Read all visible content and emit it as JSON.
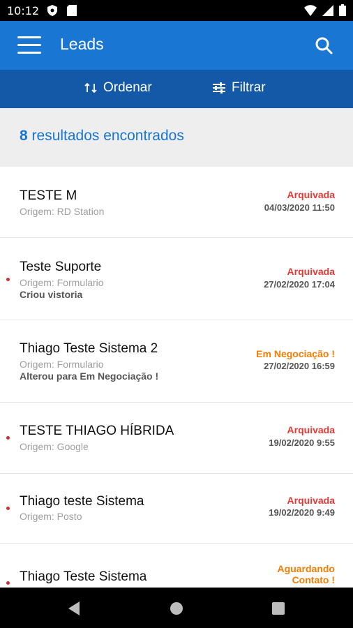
{
  "status_bar": {
    "time": "10:12"
  },
  "app_bar": {
    "title": "Leads"
  },
  "toolbar": {
    "sort_label": "Ordenar",
    "filter_label": "Filtrar"
  },
  "results": {
    "count": "8",
    "label": "resultados encontrados"
  },
  "leads": [
    {
      "name": "TESTE M",
      "origin": "Origem: RD Station",
      "activity": "",
      "status": "Arquivada",
      "status_color": "#e53935",
      "date": "04/03/2020 11:50",
      "unread": false
    },
    {
      "name": "Teste Suporte",
      "origin": "Origem: Formulario",
      "activity": "Criou vistoria",
      "status": "Arquivada",
      "status_color": "#e53935",
      "date": "27/02/2020 17:04",
      "unread": true
    },
    {
      "name": "Thiago Teste Sistema 2",
      "origin": "Origem: Formulario",
      "activity": "Alterou para Em Negociação !",
      "status": "Em Negociação !",
      "status_color": "#f57c00",
      "date": "27/02/2020 16:59",
      "unread": false
    },
    {
      "name": "TESTE THIAGO HÍBRIDA",
      "origin": "Origem: Google",
      "activity": "",
      "status": "Arquivada",
      "status_color": "#e53935",
      "date": "19/02/2020 9:55",
      "unread": true
    },
    {
      "name": "Thiago teste Sistema",
      "origin": "Origem: Posto",
      "activity": "",
      "status": "Arquivada",
      "status_color": "#e53935",
      "date": "19/02/2020 9:49",
      "unread": true
    },
    {
      "name": "Thiago Teste Sistema",
      "origin": "",
      "activity": "",
      "status_line1": "Aguardando",
      "status_line2": "Contato !",
      "status_color": "#f57c00",
      "date": "",
      "unread": true
    }
  ]
}
